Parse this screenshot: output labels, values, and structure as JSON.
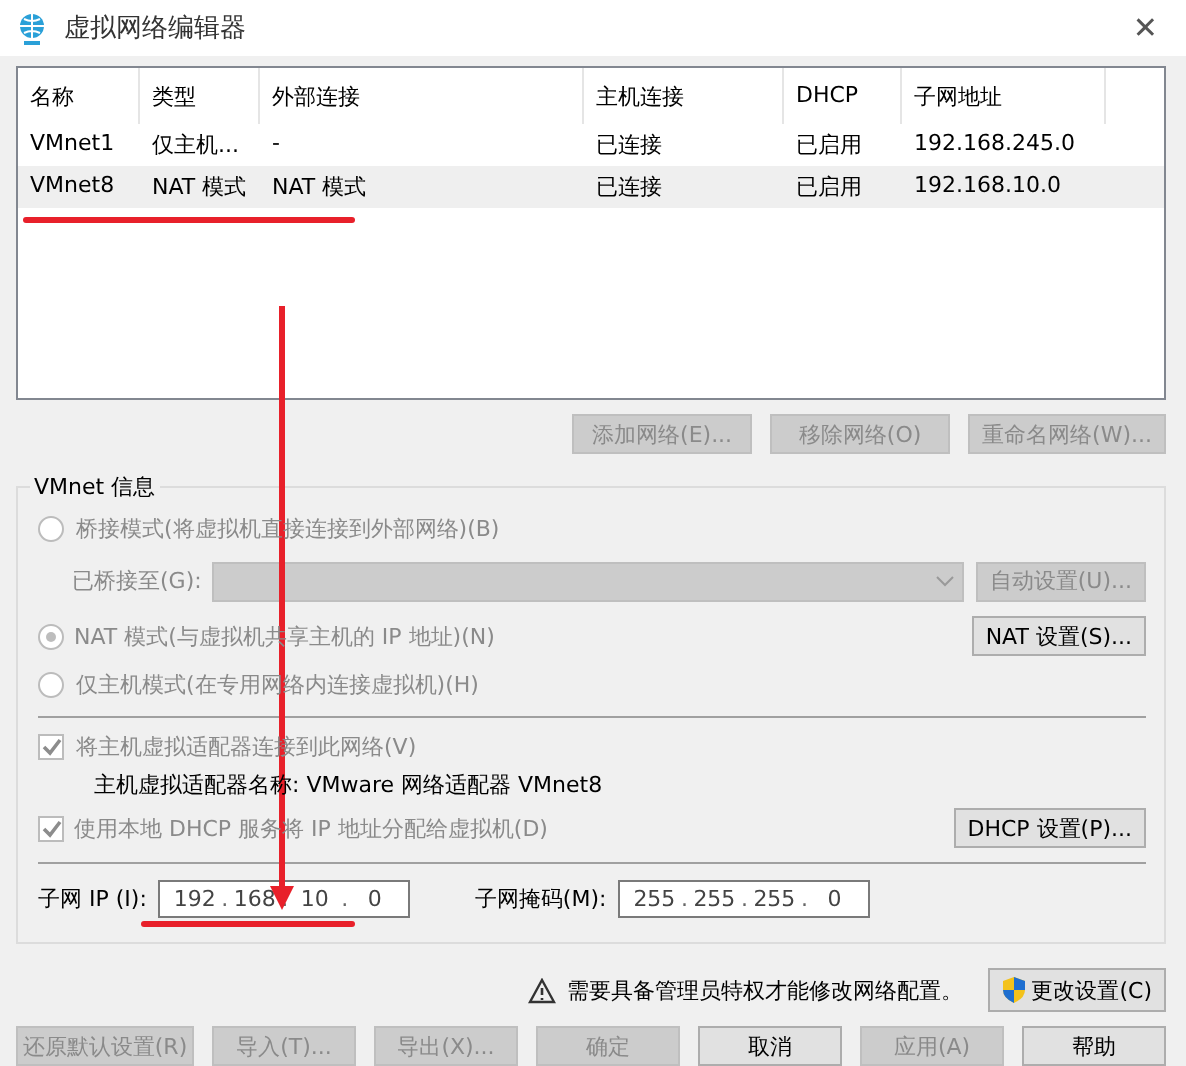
{
  "window": {
    "title": "虚拟网络编辑器",
    "close": "✕"
  },
  "table": {
    "columns": [
      "名称",
      "类型",
      "外部连接",
      "主机连接",
      "DHCP",
      "子网地址"
    ],
    "rows": [
      {
        "selected": false,
        "cells": [
          "VMnet1",
          "仅主机...",
          "-",
          "已连接",
          "已启用",
          "192.168.245.0"
        ]
      },
      {
        "selected": true,
        "cells": [
          "VMnet8",
          "NAT 模式",
          "NAT 模式",
          "已连接",
          "已启用",
          "192.168.10.0"
        ]
      }
    ]
  },
  "table_buttons": [
    {
      "label": "添加网络(E)...",
      "disabled": true
    },
    {
      "label": "移除网络(O)",
      "disabled": true
    },
    {
      "label": "重命名网络(W)...",
      "disabled": true
    }
  ],
  "vmnet_info": {
    "title": "VMnet 信息",
    "bridged": {
      "label": "桥接模式(将虚拟机直接连接到外部网络)(B)",
      "selected": false,
      "disabled": true
    },
    "bridged_to": {
      "label": "已桥接至(G):",
      "disabled": true,
      "button": {
        "label": "自动设置(U)...",
        "disabled": true
      }
    },
    "nat": {
      "label": "NAT 模式(与虚拟机共享主机的 IP 地址)(N)",
      "selected": true,
      "disabled": true,
      "button": {
        "label": "NAT 设置(S)...",
        "disabled": false
      }
    },
    "host_only": {
      "label": "仅主机模式(在专用网络内连接虚拟机)(H)",
      "selected": false,
      "disabled": true
    },
    "connect_adapter": {
      "label": "将主机虚拟适配器连接到此网络(V)",
      "checked": true,
      "disabled": true
    },
    "adapter_name": "主机虚拟适配器名称: VMware 网络适配器 VMnet8",
    "use_dhcp": {
      "label": "使用本地 DHCP 服务将 IP 地址分配给虚拟机(D)",
      "checked": true,
      "disabled": true,
      "button": {
        "label": "DHCP 设置(P)...",
        "disabled": false
      }
    },
    "subnet_ip": {
      "label": "子网 IP (I):",
      "octets": [
        "192",
        "168",
        "10",
        "0"
      ],
      "separators": [
        ".",
        ".",
        "."
      ]
    },
    "subnet_mask": {
      "label": "子网掩码(M):",
      "octets": [
        "255",
        "255",
        "255",
        "0"
      ],
      "separators": [
        ".",
        ".",
        "."
      ]
    }
  },
  "admin_notice": {
    "text": "需要具备管理员特权才能修改网络配置。",
    "button": "更改设置(C)"
  },
  "footer_buttons": [
    {
      "label": "还原默认设置(R)",
      "disabled": true
    },
    {
      "label": "导入(T)...",
      "disabled": true
    },
    {
      "label": "导出(X)...",
      "disabled": true
    },
    {
      "label": "确定",
      "disabled": true
    },
    {
      "label": "取消",
      "disabled": false
    },
    {
      "label": "应用(A)",
      "disabled": true
    },
    {
      "label": "帮助",
      "disabled": false
    }
  ]
}
